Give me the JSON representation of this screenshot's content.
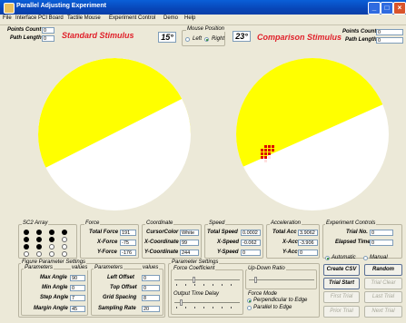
{
  "window": {
    "title": "Parallel Adjusting Experiment",
    "controls": {
      "minimize": "_",
      "maximize": "□",
      "close": "×"
    }
  },
  "menu": [
    "File",
    "Interface PCI Board",
    "Tactile Mouse",
    "Experiment Control",
    "Demo",
    "Help"
  ],
  "standard": {
    "points_count_label": "Points Count",
    "points_count": "0",
    "path_length_label": "Path Length",
    "path_length": "0",
    "heading": "Standard Stimulus",
    "angle": "15°"
  },
  "mouse_position": {
    "title": "Mouse Position",
    "left_label": "Left",
    "right_label": "Right",
    "selected": "right"
  },
  "comparison": {
    "angle": "23°",
    "heading": "Comparison Stimulus",
    "points_count_label": "Points Count",
    "points_count": "0",
    "path_length_label": "Path Length",
    "path_length": "0"
  },
  "colors": {
    "stimulus_fill": "#ffff00",
    "disc_bg": "#ffffff",
    "cursor_marks": "#dd0000"
  },
  "sc2_array": {
    "title": "SC2 Array",
    "rows": [
      [
        "filled",
        "filled",
        "filled",
        "filled"
      ],
      [
        "filled",
        "filled",
        "filled",
        "open"
      ],
      [
        "filled",
        "filled",
        "open",
        "open"
      ],
      [
        "open",
        "open",
        "open",
        "open"
      ]
    ]
  },
  "force": {
    "title": "Force",
    "total_label": "Total Force",
    "total": "191",
    "x_label": "X-Force",
    "x": "-75",
    "y_label": "Y-Force",
    "y": "-176"
  },
  "coordinate": {
    "title": "Coordinate",
    "cursor_color_label": "CursorColor",
    "cursor_color": "White",
    "x_label": "X-Coordinate",
    "x": "99",
    "y_label": "Y-Coordinate",
    "y": "244"
  },
  "speed": {
    "title": "Speed",
    "total_label": "Total Speed",
    "total": "0.0002",
    "x_label": "X-Speed",
    "x": "-0.062",
    "y_label": "Y-Speed",
    "y": "0"
  },
  "acceleration": {
    "title": "Acceleration",
    "total_label": "Total Acc",
    "total": "3.9062",
    "x_label": "X-Acc",
    "x": "-3.906",
    "y_label": "Y-Acc",
    "y": "0"
  },
  "experiment_controls": {
    "title": "Experiment Controls",
    "trial_no_label": "Trial No.",
    "trial_no": "0",
    "elapsed_label": "Elapsed Time",
    "elapsed": "0",
    "automatic_label": "Automatic",
    "manual_label": "Manual",
    "mode": "automatic"
  },
  "figure_params": {
    "title": "Figure Parameter Settings",
    "col1_header": "Parameters",
    "col1_values_header": "values",
    "col2_header": "Parameters",
    "col2_values_header": "values",
    "max_angle_label": "Max Angle",
    "max_angle": "90",
    "min_angle_label": "Min Angle",
    "min_angle": "0",
    "step_angle_label": "Step Angle",
    "step_angle": "7",
    "margin_angle_label": "Margin Angle",
    "margin_angle": "45",
    "left_offset_label": "Left Offset",
    "left_offset": "0",
    "top_offset_label": "Top Offset",
    "top_offset": "0",
    "grid_spacing_label": "Grid Spacing",
    "grid_spacing": "8",
    "sampling_rate_label": "Sampling Rate",
    "sampling_rate": "20"
  },
  "param_settings": {
    "title": "Parameter Settings",
    "force_coeff_label": "Force Coefficient",
    "updown_label": "Up-Down Ratio",
    "output_delay_label": "Output Time Delay",
    "force_mode_label": "Force Mode",
    "perpendicular_label": "Perpendicular to Edge",
    "parallel_label": "Parallel to Edge",
    "force_mode": "perpendicular"
  },
  "buttons": {
    "create_csv": "Create CSV",
    "random": "Random",
    "trial_start": "Trial Start",
    "trial_clear": "Trial Clear",
    "first_trial": "First Trial",
    "last_trial": "Last Trial",
    "prior_trial": "Prior Trial",
    "next_trial": "Next Trial"
  }
}
